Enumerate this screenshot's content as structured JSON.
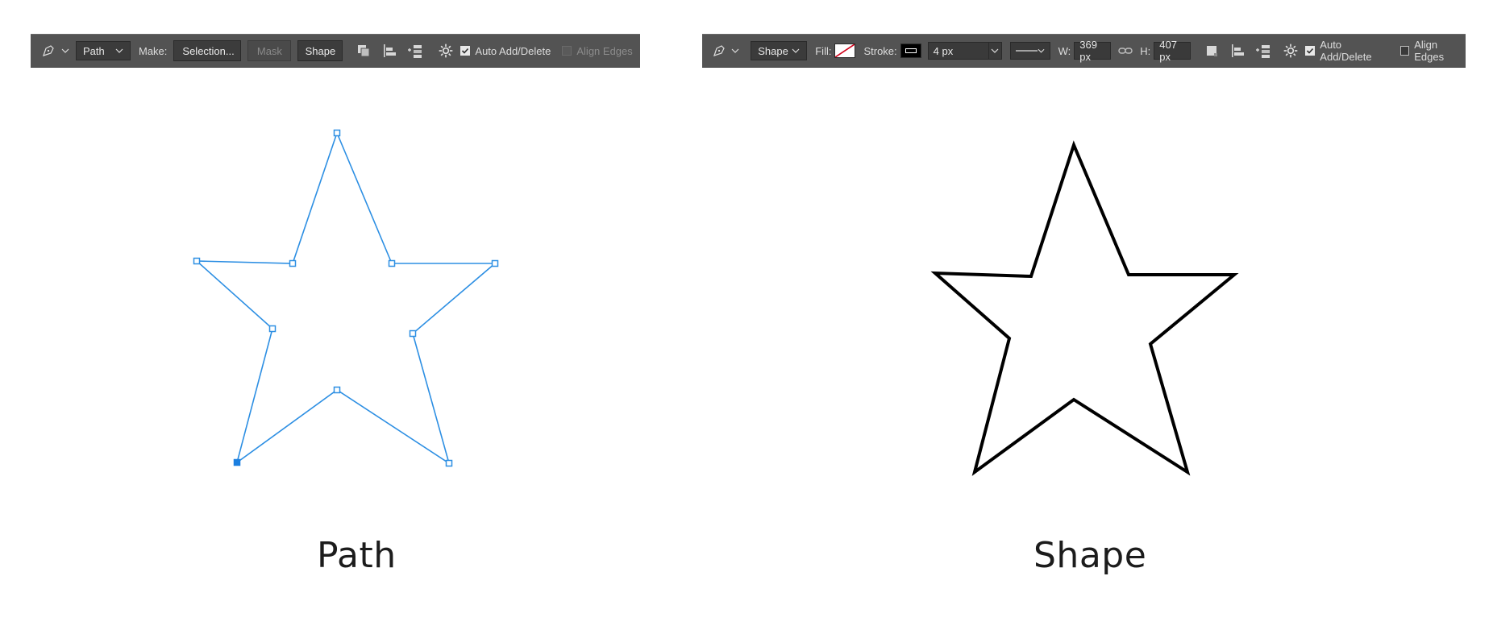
{
  "left_toolbar": {
    "mode_select": "Path",
    "make_label": "Make:",
    "selection_button": "Selection...",
    "mask_button": "Mask",
    "shape_button": "Shape",
    "auto_add_delete": "Auto Add/Delete",
    "align_edges": "Align Edges"
  },
  "right_toolbar": {
    "mode_select": "Shape",
    "fill_label": "Fill:",
    "stroke_label": "Stroke:",
    "stroke_width_value": "4 px",
    "w_label": "W:",
    "w_value": "369 px",
    "h_label": "H:",
    "h_value": "407 px",
    "auto_add_delete": "Auto Add/Delete",
    "align_edges": "Align Edges"
  },
  "captions": {
    "left": "Path",
    "right": "Shape"
  },
  "colors": {
    "path_blue": "#2d8fe3",
    "shape_black": "#000000",
    "toolbar_bg": "#535353"
  },
  "icons": [
    "pen-tool-icon",
    "chevron-down-icon",
    "path-operations-icon",
    "path-alignment-icon",
    "path-arrangement-icon",
    "gear-icon",
    "checkbox-icon",
    "link-icon",
    "fill-none-swatch",
    "stroke-swatch",
    "stroke-style-icon"
  ]
}
